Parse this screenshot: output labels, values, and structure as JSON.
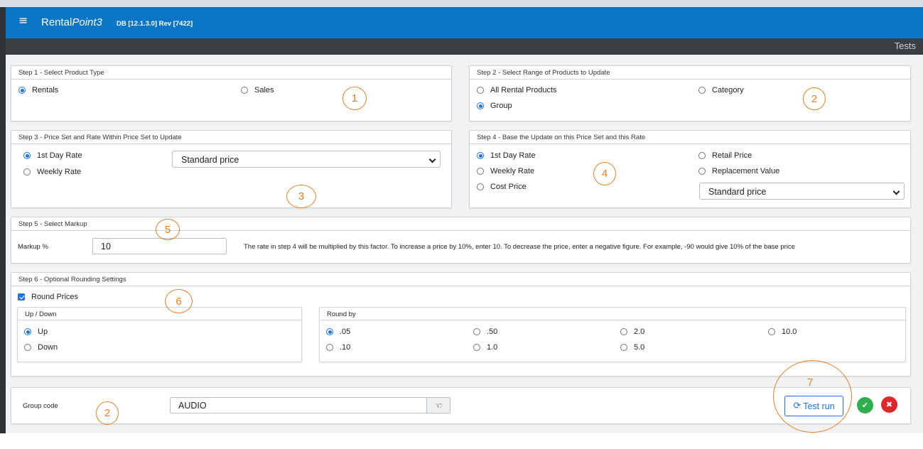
{
  "app": {
    "name_plain": "Rental",
    "name_italic": "Point3",
    "db_info": "DB [12.1.3.0]  Rev [7422]",
    "page_title": "Tests",
    "menu_glyph": "≡"
  },
  "step1": {
    "title": "Step 1 - Select Product Type",
    "options": [
      {
        "label": "Rentals",
        "selected": true
      },
      {
        "label": "Sales",
        "selected": false
      }
    ]
  },
  "step2": {
    "title": "Step 2 - Select Range of Products to Update",
    "options": [
      {
        "label": "All Rental Products",
        "selected": false
      },
      {
        "label": "Category",
        "selected": false
      },
      {
        "label": "Group",
        "selected": true
      }
    ]
  },
  "step3": {
    "title": "Step 3 - Price Set and Rate Within Price Set to Update",
    "options": [
      {
        "label": "1st Day Rate",
        "selected": true
      },
      {
        "label": "Weekly Rate",
        "selected": false
      }
    ],
    "price_set": "Standard price"
  },
  "step4": {
    "title": "Step 4 - Base the Update on this Price Set and this Rate",
    "options": [
      {
        "label": "1st Day Rate",
        "selected": true
      },
      {
        "label": "Weekly Rate",
        "selected": false
      },
      {
        "label": "Cost Price",
        "selected": false
      },
      {
        "label": "Retail Price",
        "selected": false
      },
      {
        "label": "Replacement Value",
        "selected": false
      }
    ],
    "price_set": "Standard price"
  },
  "step5": {
    "title": "Step 5 - Select Markup",
    "markup_label": "Markup %",
    "markup_value": "10",
    "hint": "The rate in step 4 will be multiplied by this factor. To increase a price by 10%, enter 10. To decrease the price, enter a negative figure. For example, -90 would give 10% of the base price"
  },
  "step6": {
    "title": "Step 6 - Optional Rounding Settings",
    "round_prices_label": "Round Prices",
    "round_prices_checked": true,
    "updown": {
      "title": "Up / Down",
      "options": [
        {
          "label": "Up",
          "selected": true
        },
        {
          "label": "Down",
          "selected": false
        }
      ]
    },
    "roundby": {
      "title": "Round by",
      "options": [
        {
          "label": ".05",
          "selected": true
        },
        {
          "label": ".50",
          "selected": false
        },
        {
          "label": "2.0",
          "selected": false
        },
        {
          "label": "10.0",
          "selected": false
        },
        {
          "label": ".10",
          "selected": false
        },
        {
          "label": "1.0",
          "selected": false
        },
        {
          "label": "5.0",
          "selected": false
        }
      ]
    }
  },
  "footer": {
    "group_code_label": "Group code",
    "group_code_value": "AUDIO",
    "test_run_label": "Test run",
    "ok_glyph": "✔",
    "cancel_glyph": "✖"
  },
  "annotations": [
    "1",
    "2",
    "3",
    "4",
    "5",
    "6",
    "7",
    "2"
  ],
  "colors": {
    "appbar": "#0a76c5",
    "subbar": "#3a3d42",
    "annotation": "#ef7d22",
    "accent": "#1a73e8",
    "ok": "#2eae4f",
    "cancel": "#e0262a"
  }
}
